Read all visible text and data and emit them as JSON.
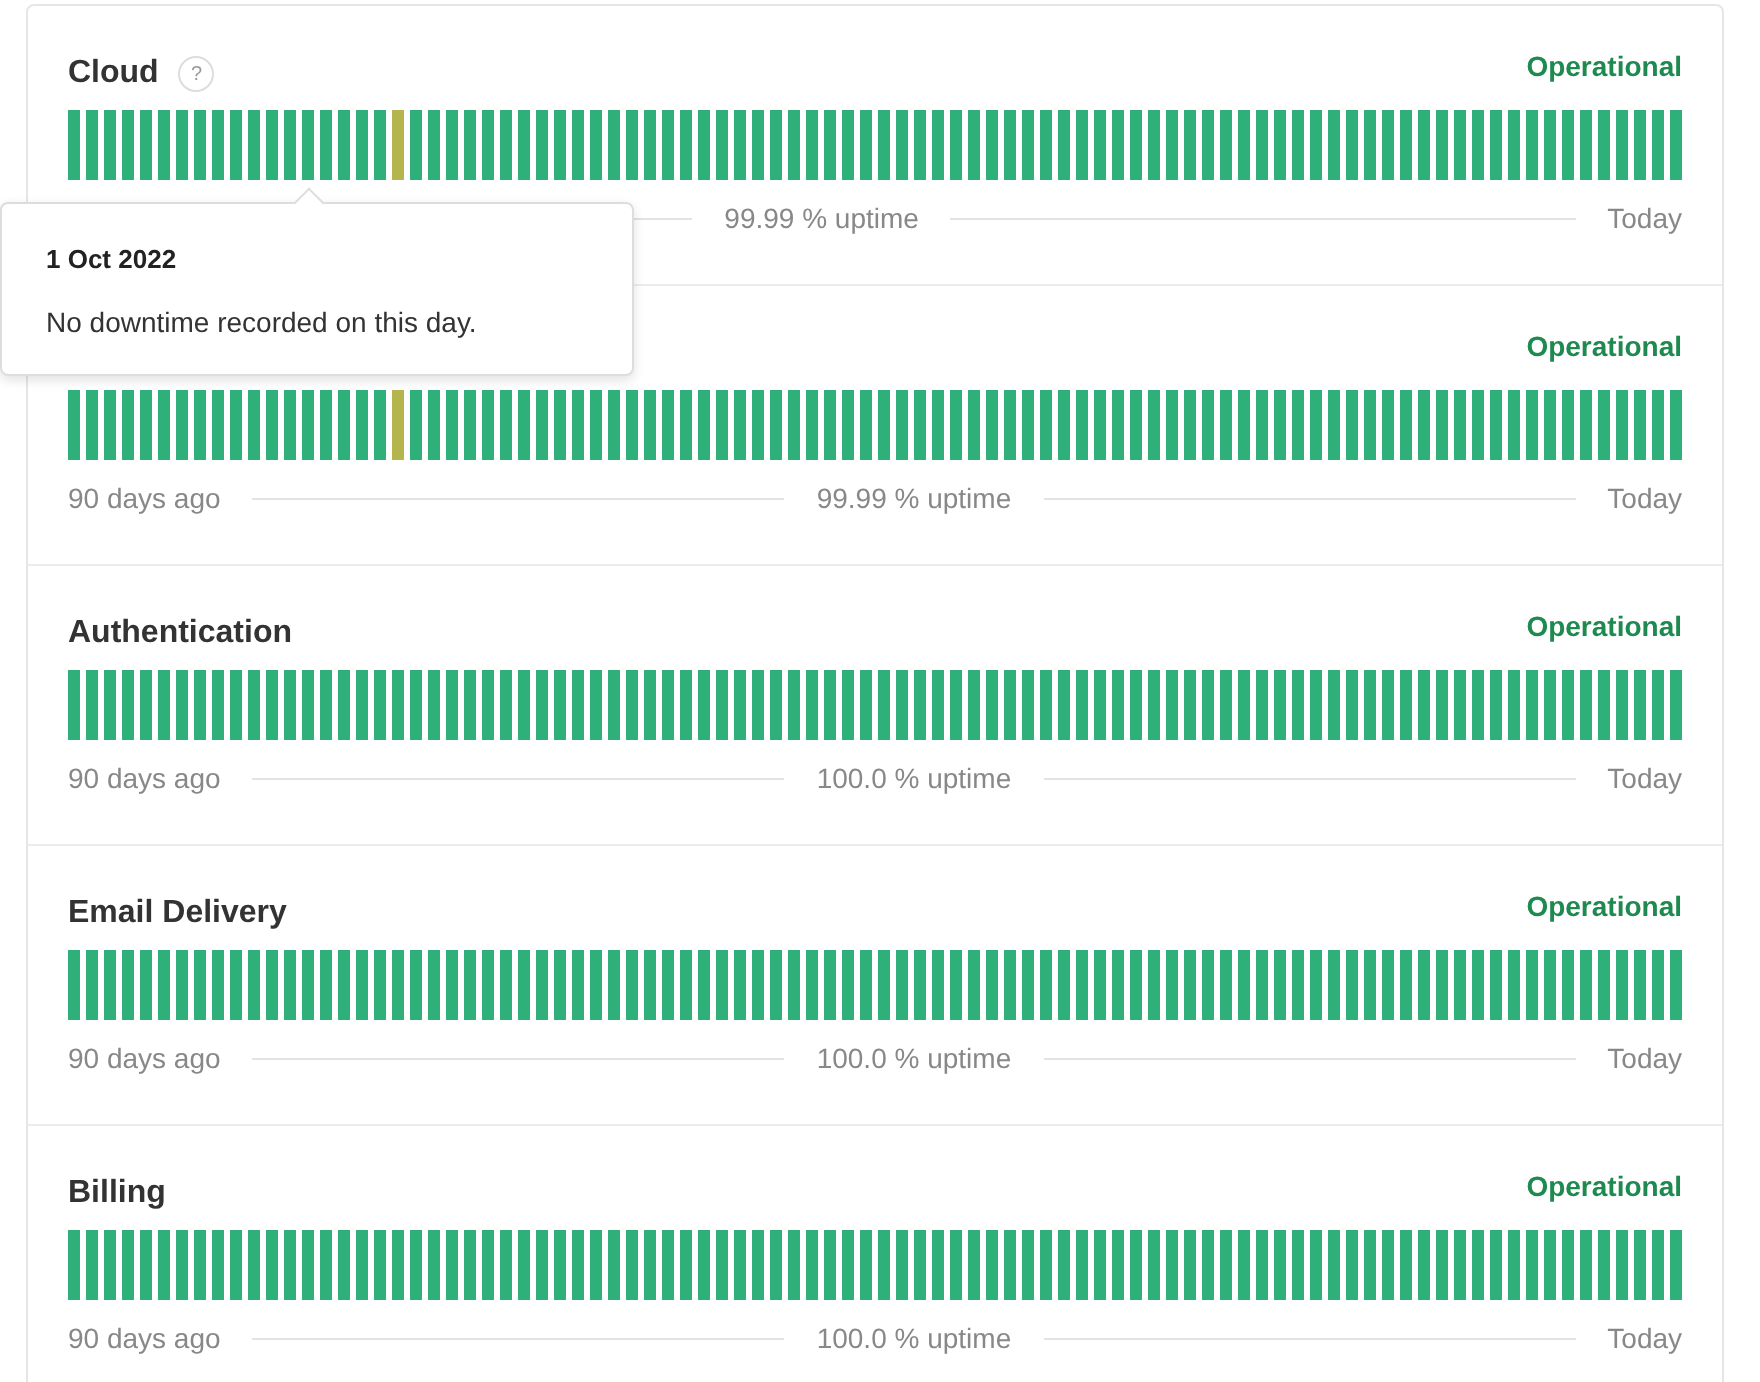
{
  "components": [
    {
      "name": "Cloud",
      "help": "?",
      "status": "Operational",
      "uptime": "99.99 % uptime",
      "end_label": "Today",
      "tooltip": {
        "date": "1 Oct 2022",
        "message": "No downtime recorded on this day."
      },
      "days": [
        {
          "color": "#2fb07a"
        },
        {
          "color": "#2fb07a"
        },
        {
          "color": "#2fb07a"
        },
        {
          "color": "#2fb07a"
        },
        {
          "color": "#2fb07a"
        },
        {
          "color": "#2fb07a"
        },
        {
          "color": "#2fb07a"
        },
        {
          "color": "#2fb07a"
        },
        {
          "color": "#2fb07a"
        },
        {
          "color": "#2fb07a"
        },
        {
          "color": "#2fb07a"
        },
        {
          "color": "#2fb07a"
        },
        {
          "color": "#2fb07a"
        },
        {
          "color": "#2fb07a"
        },
        {
          "color": "#2fb07a"
        },
        {
          "color": "#2fb07a"
        },
        {
          "color": "#2fb07a"
        },
        {
          "color": "#2fb07a"
        },
        {
          "color": "#b5b54e"
        },
        {
          "color": "#2fb07a"
        },
        {
          "color": "#2fb07a"
        },
        {
          "color": "#2fb07a"
        },
        {
          "color": "#2fb07a"
        },
        {
          "color": "#2fb07a"
        },
        {
          "color": "#2fb07a"
        },
        {
          "color": "#2fb07a"
        },
        {
          "color": "#2fb07a"
        },
        {
          "color": "#2fb07a"
        },
        {
          "color": "#2fb07a"
        },
        {
          "color": "#2fb07a"
        },
        {
          "color": "#2fb07a"
        },
        {
          "color": "#2fb07a"
        },
        {
          "color": "#2fb07a"
        },
        {
          "color": "#2fb07a"
        },
        {
          "color": "#2fb07a"
        },
        {
          "color": "#2fb07a"
        },
        {
          "color": "#2fb07a"
        },
        {
          "color": "#2fb07a"
        },
        {
          "color": "#2fb07a"
        },
        {
          "color": "#2fb07a"
        },
        {
          "color": "#2fb07a"
        },
        {
          "color": "#2fb07a"
        },
        {
          "color": "#2fb07a"
        },
        {
          "color": "#2fb07a"
        },
        {
          "color": "#2fb07a"
        },
        {
          "color": "#2fb07a"
        },
        {
          "color": "#2fb07a"
        },
        {
          "color": "#2fb07a"
        },
        {
          "color": "#2fb07a"
        },
        {
          "color": "#2fb07a"
        },
        {
          "color": "#2fb07a"
        },
        {
          "color": "#2fb07a"
        },
        {
          "color": "#2fb07a"
        },
        {
          "color": "#2fb07a"
        },
        {
          "color": "#2fb07a"
        },
        {
          "color": "#2fb07a"
        },
        {
          "color": "#2fb07a"
        },
        {
          "color": "#2fb07a"
        },
        {
          "color": "#2fb07a"
        },
        {
          "color": "#2fb07a"
        },
        {
          "color": "#2fb07a"
        },
        {
          "color": "#2fb07a"
        },
        {
          "color": "#2fb07a"
        },
        {
          "color": "#2fb07a"
        },
        {
          "color": "#2fb07a"
        },
        {
          "color": "#2fb07a"
        },
        {
          "color": "#2fb07a"
        },
        {
          "color": "#2fb07a"
        },
        {
          "color": "#2fb07a"
        },
        {
          "color": "#2fb07a"
        },
        {
          "color": "#2fb07a"
        },
        {
          "color": "#2fb07a"
        },
        {
          "color": "#2fb07a"
        },
        {
          "color": "#2fb07a"
        },
        {
          "color": "#2fb07a"
        },
        {
          "color": "#2fb07a"
        },
        {
          "color": "#2fb07a"
        },
        {
          "color": "#2fb07a"
        },
        {
          "color": "#2fb07a"
        },
        {
          "color": "#2fb07a"
        },
        {
          "color": "#2fb07a"
        },
        {
          "color": "#2fb07a"
        },
        {
          "color": "#2fb07a"
        },
        {
          "color": "#2fb07a"
        },
        {
          "color": "#2fb07a"
        },
        {
          "color": "#2fb07a"
        },
        {
          "color": "#2fb07a"
        },
        {
          "color": "#2fb07a"
        },
        {
          "color": "#2fb07a"
        },
        {
          "color": "#2fb07a"
        }
      ]
    },
    {
      "status": "Operational",
      "start_label": "90 days ago",
      "uptime": "99.99 % uptime",
      "end_label": "Today",
      "days": [
        {
          "color": "#2fb07a"
        },
        {
          "color": "#2fb07a"
        },
        {
          "color": "#2fb07a"
        },
        {
          "color": "#2fb07a"
        },
        {
          "color": "#2fb07a"
        },
        {
          "color": "#2fb07a"
        },
        {
          "color": "#2fb07a"
        },
        {
          "color": "#2fb07a"
        },
        {
          "color": "#2fb07a"
        },
        {
          "color": "#2fb07a"
        },
        {
          "color": "#2fb07a"
        },
        {
          "color": "#2fb07a"
        },
        {
          "color": "#2fb07a"
        },
        {
          "color": "#2fb07a"
        },
        {
          "color": "#2fb07a"
        },
        {
          "color": "#2fb07a"
        },
        {
          "color": "#2fb07a"
        },
        {
          "color": "#2fb07a"
        },
        {
          "color": "#b5b54e"
        },
        {
          "color": "#2fb07a"
        },
        {
          "color": "#2fb07a"
        },
        {
          "color": "#2fb07a"
        },
        {
          "color": "#2fb07a"
        },
        {
          "color": "#2fb07a"
        },
        {
          "color": "#2fb07a"
        },
        {
          "color": "#2fb07a"
        },
        {
          "color": "#2fb07a"
        },
        {
          "color": "#2fb07a"
        },
        {
          "color": "#2fb07a"
        },
        {
          "color": "#2fb07a"
        },
        {
          "color": "#2fb07a"
        },
        {
          "color": "#2fb07a"
        },
        {
          "color": "#2fb07a"
        },
        {
          "color": "#2fb07a"
        },
        {
          "color": "#2fb07a"
        },
        {
          "color": "#2fb07a"
        },
        {
          "color": "#2fb07a"
        },
        {
          "color": "#2fb07a"
        },
        {
          "color": "#2fb07a"
        },
        {
          "color": "#2fb07a"
        },
        {
          "color": "#2fb07a"
        },
        {
          "color": "#2fb07a"
        },
        {
          "color": "#2fb07a"
        },
        {
          "color": "#2fb07a"
        },
        {
          "color": "#2fb07a"
        },
        {
          "color": "#2fb07a"
        },
        {
          "color": "#2fb07a"
        },
        {
          "color": "#2fb07a"
        },
        {
          "color": "#2fb07a"
        },
        {
          "color": "#2fb07a"
        },
        {
          "color": "#2fb07a"
        },
        {
          "color": "#2fb07a"
        },
        {
          "color": "#2fb07a"
        },
        {
          "color": "#2fb07a"
        },
        {
          "color": "#2fb07a"
        },
        {
          "color": "#2fb07a"
        },
        {
          "color": "#2fb07a"
        },
        {
          "color": "#2fb07a"
        },
        {
          "color": "#2fb07a"
        },
        {
          "color": "#2fb07a"
        },
        {
          "color": "#2fb07a"
        },
        {
          "color": "#2fb07a"
        },
        {
          "color": "#2fb07a"
        },
        {
          "color": "#2fb07a"
        },
        {
          "color": "#2fb07a"
        },
        {
          "color": "#2fb07a"
        },
        {
          "color": "#2fb07a"
        },
        {
          "color": "#2fb07a"
        },
        {
          "color": "#2fb07a"
        },
        {
          "color": "#2fb07a"
        },
        {
          "color": "#2fb07a"
        },
        {
          "color": "#2fb07a"
        },
        {
          "color": "#2fb07a"
        },
        {
          "color": "#2fb07a"
        },
        {
          "color": "#2fb07a"
        },
        {
          "color": "#2fb07a"
        },
        {
          "color": "#2fb07a"
        },
        {
          "color": "#2fb07a"
        },
        {
          "color": "#2fb07a"
        },
        {
          "color": "#2fb07a"
        },
        {
          "color": "#2fb07a"
        },
        {
          "color": "#2fb07a"
        },
        {
          "color": "#2fb07a"
        },
        {
          "color": "#2fb07a"
        },
        {
          "color": "#2fb07a"
        },
        {
          "color": "#2fb07a"
        },
        {
          "color": "#2fb07a"
        },
        {
          "color": "#2fb07a"
        },
        {
          "color": "#2fb07a"
        },
        {
          "color": "#2fb07a"
        }
      ]
    },
    {
      "name": "Authentication",
      "status": "Operational",
      "start_label": "90 days ago",
      "uptime": "100.0 % uptime",
      "end_label": "Today",
      "days": [
        {
          "color": "#2fb07a"
        },
        {
          "color": "#2fb07a"
        },
        {
          "color": "#2fb07a"
        },
        {
          "color": "#2fb07a"
        },
        {
          "color": "#2fb07a"
        },
        {
          "color": "#2fb07a"
        },
        {
          "color": "#2fb07a"
        },
        {
          "color": "#2fb07a"
        },
        {
          "color": "#2fb07a"
        },
        {
          "color": "#2fb07a"
        },
        {
          "color": "#2fb07a"
        },
        {
          "color": "#2fb07a"
        },
        {
          "color": "#2fb07a"
        },
        {
          "color": "#2fb07a"
        },
        {
          "color": "#2fb07a"
        },
        {
          "color": "#2fb07a"
        },
        {
          "color": "#2fb07a"
        },
        {
          "color": "#2fb07a"
        },
        {
          "color": "#2fb07a"
        },
        {
          "color": "#2fb07a"
        },
        {
          "color": "#2fb07a"
        },
        {
          "color": "#2fb07a"
        },
        {
          "color": "#2fb07a"
        },
        {
          "color": "#2fb07a"
        },
        {
          "color": "#2fb07a"
        },
        {
          "color": "#2fb07a"
        },
        {
          "color": "#2fb07a"
        },
        {
          "color": "#2fb07a"
        },
        {
          "color": "#2fb07a"
        },
        {
          "color": "#2fb07a"
        },
        {
          "color": "#2fb07a"
        },
        {
          "color": "#2fb07a"
        },
        {
          "color": "#2fb07a"
        },
        {
          "color": "#2fb07a"
        },
        {
          "color": "#2fb07a"
        },
        {
          "color": "#2fb07a"
        },
        {
          "color": "#2fb07a"
        },
        {
          "color": "#2fb07a"
        },
        {
          "color": "#2fb07a"
        },
        {
          "color": "#2fb07a"
        },
        {
          "color": "#2fb07a"
        },
        {
          "color": "#2fb07a"
        },
        {
          "color": "#2fb07a"
        },
        {
          "color": "#2fb07a"
        },
        {
          "color": "#2fb07a"
        },
        {
          "color": "#2fb07a"
        },
        {
          "color": "#2fb07a"
        },
        {
          "color": "#2fb07a"
        },
        {
          "color": "#2fb07a"
        },
        {
          "color": "#2fb07a"
        },
        {
          "color": "#2fb07a"
        },
        {
          "color": "#2fb07a"
        },
        {
          "color": "#2fb07a"
        },
        {
          "color": "#2fb07a"
        },
        {
          "color": "#2fb07a"
        },
        {
          "color": "#2fb07a"
        },
        {
          "color": "#2fb07a"
        },
        {
          "color": "#2fb07a"
        },
        {
          "color": "#2fb07a"
        },
        {
          "color": "#2fb07a"
        },
        {
          "color": "#2fb07a"
        },
        {
          "color": "#2fb07a"
        },
        {
          "color": "#2fb07a"
        },
        {
          "color": "#2fb07a"
        },
        {
          "color": "#2fb07a"
        },
        {
          "color": "#2fb07a"
        },
        {
          "color": "#2fb07a"
        },
        {
          "color": "#2fb07a"
        },
        {
          "color": "#2fb07a"
        },
        {
          "color": "#2fb07a"
        },
        {
          "color": "#2fb07a"
        },
        {
          "color": "#2fb07a"
        },
        {
          "color": "#2fb07a"
        },
        {
          "color": "#2fb07a"
        },
        {
          "color": "#2fb07a"
        },
        {
          "color": "#2fb07a"
        },
        {
          "color": "#2fb07a"
        },
        {
          "color": "#2fb07a"
        },
        {
          "color": "#2fb07a"
        },
        {
          "color": "#2fb07a"
        },
        {
          "color": "#2fb07a"
        },
        {
          "color": "#2fb07a"
        },
        {
          "color": "#2fb07a"
        },
        {
          "color": "#2fb07a"
        },
        {
          "color": "#2fb07a"
        },
        {
          "color": "#2fb07a"
        },
        {
          "color": "#2fb07a"
        },
        {
          "color": "#2fb07a"
        },
        {
          "color": "#2fb07a"
        },
        {
          "color": "#2fb07a"
        }
      ]
    },
    {
      "name": "Email Delivery",
      "status": "Operational",
      "start_label": "90 days ago",
      "uptime": "100.0 % uptime",
      "end_label": "Today",
      "days": [
        {
          "color": "#2fb07a"
        },
        {
          "color": "#2fb07a"
        },
        {
          "color": "#2fb07a"
        },
        {
          "color": "#2fb07a"
        },
        {
          "color": "#2fb07a"
        },
        {
          "color": "#2fb07a"
        },
        {
          "color": "#2fb07a"
        },
        {
          "color": "#2fb07a"
        },
        {
          "color": "#2fb07a"
        },
        {
          "color": "#2fb07a"
        },
        {
          "color": "#2fb07a"
        },
        {
          "color": "#2fb07a"
        },
        {
          "color": "#2fb07a"
        },
        {
          "color": "#2fb07a"
        },
        {
          "color": "#2fb07a"
        },
        {
          "color": "#2fb07a"
        },
        {
          "color": "#2fb07a"
        },
        {
          "color": "#2fb07a"
        },
        {
          "color": "#2fb07a"
        },
        {
          "color": "#2fb07a"
        },
        {
          "color": "#2fb07a"
        },
        {
          "color": "#2fb07a"
        },
        {
          "color": "#2fb07a"
        },
        {
          "color": "#2fb07a"
        },
        {
          "color": "#2fb07a"
        },
        {
          "color": "#2fb07a"
        },
        {
          "color": "#2fb07a"
        },
        {
          "color": "#2fb07a"
        },
        {
          "color": "#2fb07a"
        },
        {
          "color": "#2fb07a"
        },
        {
          "color": "#2fb07a"
        },
        {
          "color": "#2fb07a"
        },
        {
          "color": "#2fb07a"
        },
        {
          "color": "#2fb07a"
        },
        {
          "color": "#2fb07a"
        },
        {
          "color": "#2fb07a"
        },
        {
          "color": "#2fb07a"
        },
        {
          "color": "#2fb07a"
        },
        {
          "color": "#2fb07a"
        },
        {
          "color": "#2fb07a"
        },
        {
          "color": "#2fb07a"
        },
        {
          "color": "#2fb07a"
        },
        {
          "color": "#2fb07a"
        },
        {
          "color": "#2fb07a"
        },
        {
          "color": "#2fb07a"
        },
        {
          "color": "#2fb07a"
        },
        {
          "color": "#2fb07a"
        },
        {
          "color": "#2fb07a"
        },
        {
          "color": "#2fb07a"
        },
        {
          "color": "#2fb07a"
        },
        {
          "color": "#2fb07a"
        },
        {
          "color": "#2fb07a"
        },
        {
          "color": "#2fb07a"
        },
        {
          "color": "#2fb07a"
        },
        {
          "color": "#2fb07a"
        },
        {
          "color": "#2fb07a"
        },
        {
          "color": "#2fb07a"
        },
        {
          "color": "#2fb07a"
        },
        {
          "color": "#2fb07a"
        },
        {
          "color": "#2fb07a"
        },
        {
          "color": "#2fb07a"
        },
        {
          "color": "#2fb07a"
        },
        {
          "color": "#2fb07a"
        },
        {
          "color": "#2fb07a"
        },
        {
          "color": "#2fb07a"
        },
        {
          "color": "#2fb07a"
        },
        {
          "color": "#2fb07a"
        },
        {
          "color": "#2fb07a"
        },
        {
          "color": "#2fb07a"
        },
        {
          "color": "#2fb07a"
        },
        {
          "color": "#2fb07a"
        },
        {
          "color": "#2fb07a"
        },
        {
          "color": "#2fb07a"
        },
        {
          "color": "#2fb07a"
        },
        {
          "color": "#2fb07a"
        },
        {
          "color": "#2fb07a"
        },
        {
          "color": "#2fb07a"
        },
        {
          "color": "#2fb07a"
        },
        {
          "color": "#2fb07a"
        },
        {
          "color": "#2fb07a"
        },
        {
          "color": "#2fb07a"
        },
        {
          "color": "#2fb07a"
        },
        {
          "color": "#2fb07a"
        },
        {
          "color": "#2fb07a"
        },
        {
          "color": "#2fb07a"
        },
        {
          "color": "#2fb07a"
        },
        {
          "color": "#2fb07a"
        },
        {
          "color": "#2fb07a"
        },
        {
          "color": "#2fb07a"
        },
        {
          "color": "#2fb07a"
        }
      ]
    },
    {
      "name": "Billing",
      "status": "Operational",
      "start_label": "90 days ago",
      "uptime": "100.0 % uptime",
      "end_label": "Today",
      "days": [
        {
          "color": "#2fb07a"
        },
        {
          "color": "#2fb07a"
        },
        {
          "color": "#2fb07a"
        },
        {
          "color": "#2fb07a"
        },
        {
          "color": "#2fb07a"
        },
        {
          "color": "#2fb07a"
        },
        {
          "color": "#2fb07a"
        },
        {
          "color": "#2fb07a"
        },
        {
          "color": "#2fb07a"
        },
        {
          "color": "#2fb07a"
        },
        {
          "color": "#2fb07a"
        },
        {
          "color": "#2fb07a"
        },
        {
          "color": "#2fb07a"
        },
        {
          "color": "#2fb07a"
        },
        {
          "color": "#2fb07a"
        },
        {
          "color": "#2fb07a"
        },
        {
          "color": "#2fb07a"
        },
        {
          "color": "#2fb07a"
        },
        {
          "color": "#2fb07a"
        },
        {
          "color": "#2fb07a"
        },
        {
          "color": "#2fb07a"
        },
        {
          "color": "#2fb07a"
        },
        {
          "color": "#2fb07a"
        },
        {
          "color": "#2fb07a"
        },
        {
          "color": "#2fb07a"
        },
        {
          "color": "#2fb07a"
        },
        {
          "color": "#2fb07a"
        },
        {
          "color": "#2fb07a"
        },
        {
          "color": "#2fb07a"
        },
        {
          "color": "#2fb07a"
        },
        {
          "color": "#2fb07a"
        },
        {
          "color": "#2fb07a"
        },
        {
          "color": "#2fb07a"
        },
        {
          "color": "#2fb07a"
        },
        {
          "color": "#2fb07a"
        },
        {
          "color": "#2fb07a"
        },
        {
          "color": "#2fb07a"
        },
        {
          "color": "#2fb07a"
        },
        {
          "color": "#2fb07a"
        },
        {
          "color": "#2fb07a"
        },
        {
          "color": "#2fb07a"
        },
        {
          "color": "#2fb07a"
        },
        {
          "color": "#2fb07a"
        },
        {
          "color": "#2fb07a"
        },
        {
          "color": "#2fb07a"
        },
        {
          "color": "#2fb07a"
        },
        {
          "color": "#2fb07a"
        },
        {
          "color": "#2fb07a"
        },
        {
          "color": "#2fb07a"
        },
        {
          "color": "#2fb07a"
        },
        {
          "color": "#2fb07a"
        },
        {
          "color": "#2fb07a"
        },
        {
          "color": "#2fb07a"
        },
        {
          "color": "#2fb07a"
        },
        {
          "color": "#2fb07a"
        },
        {
          "color": "#2fb07a"
        },
        {
          "color": "#2fb07a"
        },
        {
          "color": "#2fb07a"
        },
        {
          "color": "#2fb07a"
        },
        {
          "color": "#2fb07a"
        },
        {
          "color": "#2fb07a"
        },
        {
          "color": "#2fb07a"
        },
        {
          "color": "#2fb07a"
        },
        {
          "color": "#2fb07a"
        },
        {
          "color": "#2fb07a"
        },
        {
          "color": "#2fb07a"
        },
        {
          "color": "#2fb07a"
        },
        {
          "color": "#2fb07a"
        },
        {
          "color": "#2fb07a"
        },
        {
          "color": "#2fb07a"
        },
        {
          "color": "#2fb07a"
        },
        {
          "color": "#2fb07a"
        },
        {
          "color": "#2fb07a"
        },
        {
          "color": "#2fb07a"
        },
        {
          "color": "#2fb07a"
        },
        {
          "color": "#2fb07a"
        },
        {
          "color": "#2fb07a"
        },
        {
          "color": "#2fb07a"
        },
        {
          "color": "#2fb07a"
        },
        {
          "color": "#2fb07a"
        },
        {
          "color": "#2fb07a"
        },
        {
          "color": "#2fb07a"
        },
        {
          "color": "#2fb07a"
        },
        {
          "color": "#2fb07a"
        },
        {
          "color": "#2fb07a"
        },
        {
          "color": "#2fb07a"
        },
        {
          "color": "#2fb07a"
        },
        {
          "color": "#2fb07a"
        },
        {
          "color": "#2fb07a"
        },
        {
          "color": "#2fb07a"
        }
      ]
    }
  ]
}
